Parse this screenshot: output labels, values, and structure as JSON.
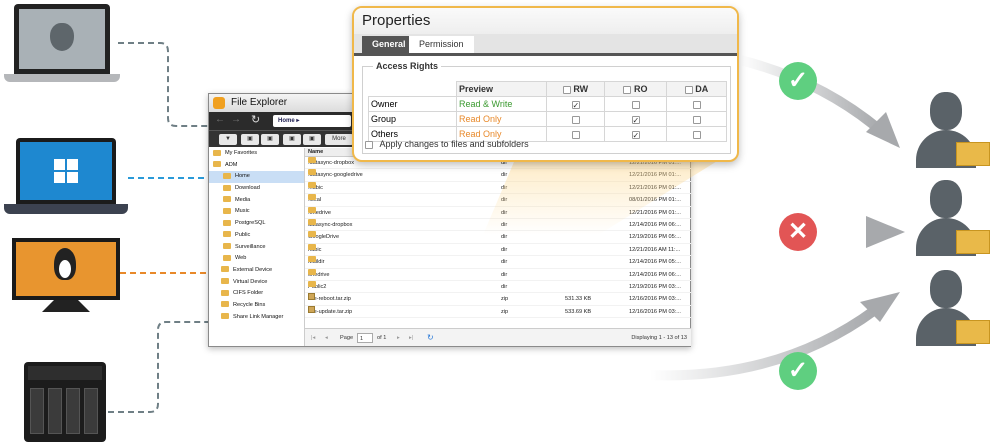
{
  "file_explorer": {
    "title": "File Explorer",
    "path": "Home",
    "more_label": "More",
    "column_name": "Name",
    "sidebar": [
      "My Favorites",
      "ADM",
      "Home",
      "Download",
      "Media",
      "Music",
      "PostgreSQL",
      "Public",
      "Surveillance",
      "Web",
      "External Device",
      "Virtual Device",
      "CIFS Folder",
      "Recycle Bins",
      "Share Link Manager"
    ],
    "files": [
      {
        "name": ".datasync-dropbox",
        "type": "dir",
        "size": "",
        "date": "12/21/2016 PM 01:..."
      },
      {
        "name": ".datasync-googledrive",
        "type": "dir",
        "size": "",
        "date": "12/21/2016 PM 01:..."
      },
      {
        "name": ".hubic",
        "type": "dir",
        "size": "",
        "date": "12/21/2016 PM 01:..."
      },
      {
        "name": ".local",
        "type": "dir",
        "size": "",
        "date": "08/01/2016 PM 01:..."
      },
      {
        "name": ".onedrive",
        "type": "dir",
        "size": "",
        "date": "12/21/2016 PM 01:..."
      },
      {
        "name": "datasync-dropbox",
        "type": "dir",
        "size": "",
        "date": "12/14/2016 PM 06:..."
      },
      {
        "name": "GoogleDrive",
        "type": "dir",
        "size": "",
        "date": "12/19/2016 PM 05:..."
      },
      {
        "name": "hubic",
        "type": "dir",
        "size": "",
        "date": "12/21/2016 AM 11:..."
      },
      {
        "name": "Maildir",
        "type": "dir",
        "size": "",
        "date": "12/14/2016 PM 05:..."
      },
      {
        "name": "onedrive",
        "type": "dir",
        "size": "",
        "date": "12/14/2016 PM 06:..."
      },
      {
        "name": "Public2",
        "type": "dir",
        "size": "",
        "date": "12/19/2016 PM 03:..."
      },
      {
        "name": "Pre-reboot.tar.zip",
        "type": "zip",
        "size": "531.33 KB",
        "date": "12/16/2016 PM 03:..."
      },
      {
        "name": "Pre-update.tar.zip",
        "type": "zip",
        "size": "533.69 KB",
        "date": "12/16/2016 PM 03:..."
      }
    ],
    "pager": {
      "page_label": "Page",
      "page_value": "1",
      "of_label": "of 1",
      "display": "Displaying 1 - 13 of 13"
    }
  },
  "properties": {
    "title": "Properties",
    "tabs": [
      "General",
      "Permission"
    ],
    "section": "Access Rights",
    "columns": [
      "Preview",
      "RW",
      "RO",
      "DA"
    ],
    "rows": [
      {
        "label": "Owner",
        "preview": "Read & Write",
        "rw": true,
        "ro": false,
        "da": false
      },
      {
        "label": "Group",
        "preview": "Read Only",
        "rw": false,
        "ro": true,
        "da": false
      },
      {
        "label": "Others",
        "preview": "Read Only",
        "rw": false,
        "ro": true,
        "da": false
      }
    ],
    "apply_label": "Apply changes to files and subfolders"
  },
  "colors": {
    "accent": "#f0b84a",
    "allow": "#5fcf80",
    "deny": "#e25555",
    "line_orange": "#e8892a",
    "line_blue": "#2a9ad8",
    "line_gray": "#6f7f85"
  }
}
